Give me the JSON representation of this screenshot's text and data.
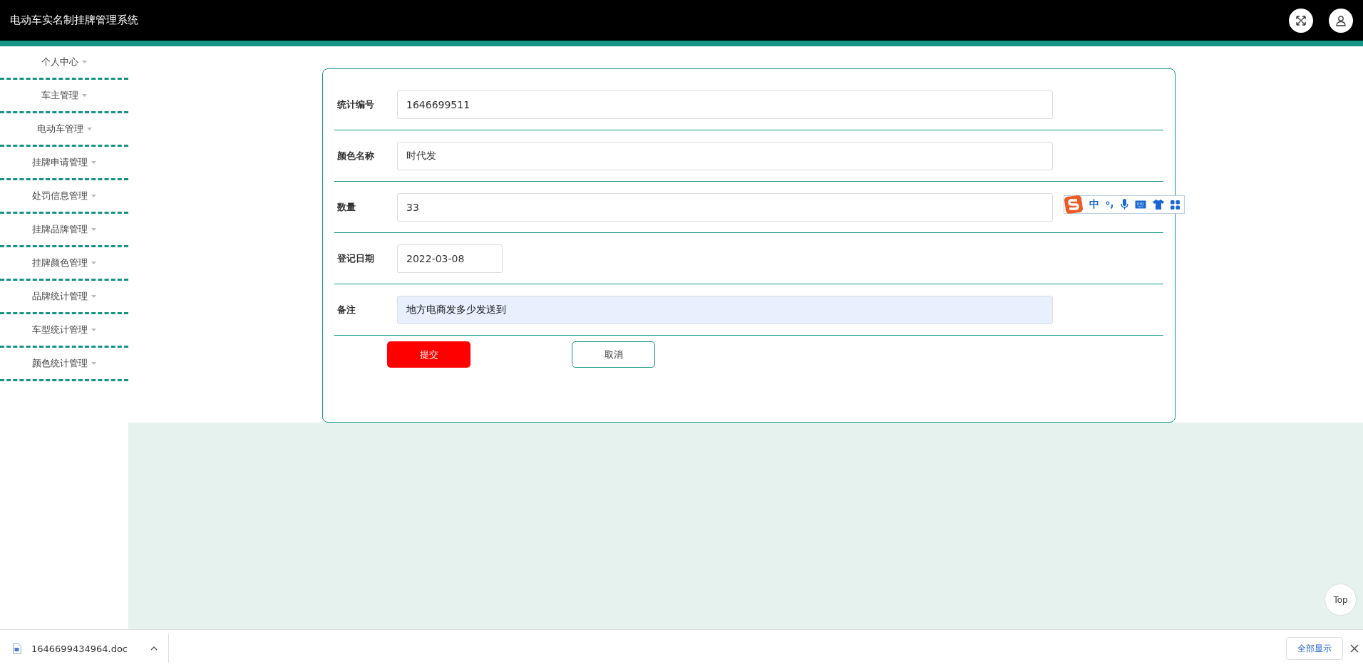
{
  "header": {
    "title": "电动车实名制挂牌管理系统"
  },
  "sidebar": {
    "items": [
      {
        "label": "个人中心"
      },
      {
        "label": "车主管理"
      },
      {
        "label": "电动车管理"
      },
      {
        "label": "挂牌申请管理"
      },
      {
        "label": "处罚信息管理"
      },
      {
        "label": "挂牌品牌管理"
      },
      {
        "label": "挂牌颜色管理"
      },
      {
        "label": "品牌统计管理"
      },
      {
        "label": "车型统计管理"
      },
      {
        "label": "颜色统计管理"
      }
    ]
  },
  "form": {
    "fields": [
      {
        "label": "统计编号",
        "value": "1646699511",
        "kind": "text",
        "focused": false
      },
      {
        "label": "颜色名称",
        "value": "时代发",
        "kind": "text",
        "focused": false
      },
      {
        "label": "数量",
        "value": "33",
        "kind": "text",
        "focused": false
      },
      {
        "label": "登记日期",
        "value": "2022-03-08",
        "kind": "date",
        "focused": false
      },
      {
        "label": "备注",
        "value": "地方电商发多少发送到",
        "kind": "text",
        "focused": true
      }
    ],
    "buttons": [
      {
        "label": "提交",
        "kind": "primary"
      },
      {
        "label": "取消",
        "kind": "secondary"
      }
    ]
  },
  "top_button": "Top",
  "ime_toolbar": {
    "mode": "中"
  },
  "download_bar": {
    "file": "1646699434964.doc",
    "show_all": "全部显示"
  }
}
